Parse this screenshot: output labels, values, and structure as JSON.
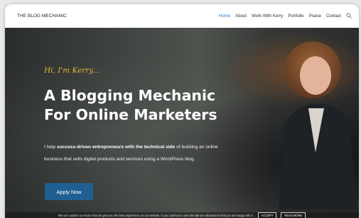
{
  "header": {
    "brand": "THE BLOG MECHANIC",
    "menu": [
      {
        "label": "Home",
        "active": true
      },
      {
        "label": "About",
        "active": false
      },
      {
        "label": "Work With Kerry",
        "active": false
      },
      {
        "label": "Portfolio",
        "active": false
      },
      {
        "label": "Praise",
        "active": false
      },
      {
        "label": "Contact",
        "active": false
      }
    ],
    "search_icon": "search-icon",
    "active_color": "#2a7fc9"
  },
  "hero": {
    "tagline": "Hi, I'm Kerry...",
    "headline_line1": "A Blogging Mechanic",
    "headline_line2": "For Online Marketers",
    "intro_part1": "I help ",
    "intro_bold": "success-driven entrepreneurs with the technical side",
    "intro_part2": " of building an online business that sells digital products and services using a WordPress blog.",
    "cta_label": "Apply Now",
    "cta_color": "#1f5f92",
    "tagline_color": "#e7b736"
  },
  "cookie_bar": {
    "text": "We use cookies to ensure that we give you the best experience on our website. If you continue to use this site we will assume that you are happy with it.",
    "accept_label": "ACCEPT",
    "read_more_label": "READ MORE"
  }
}
